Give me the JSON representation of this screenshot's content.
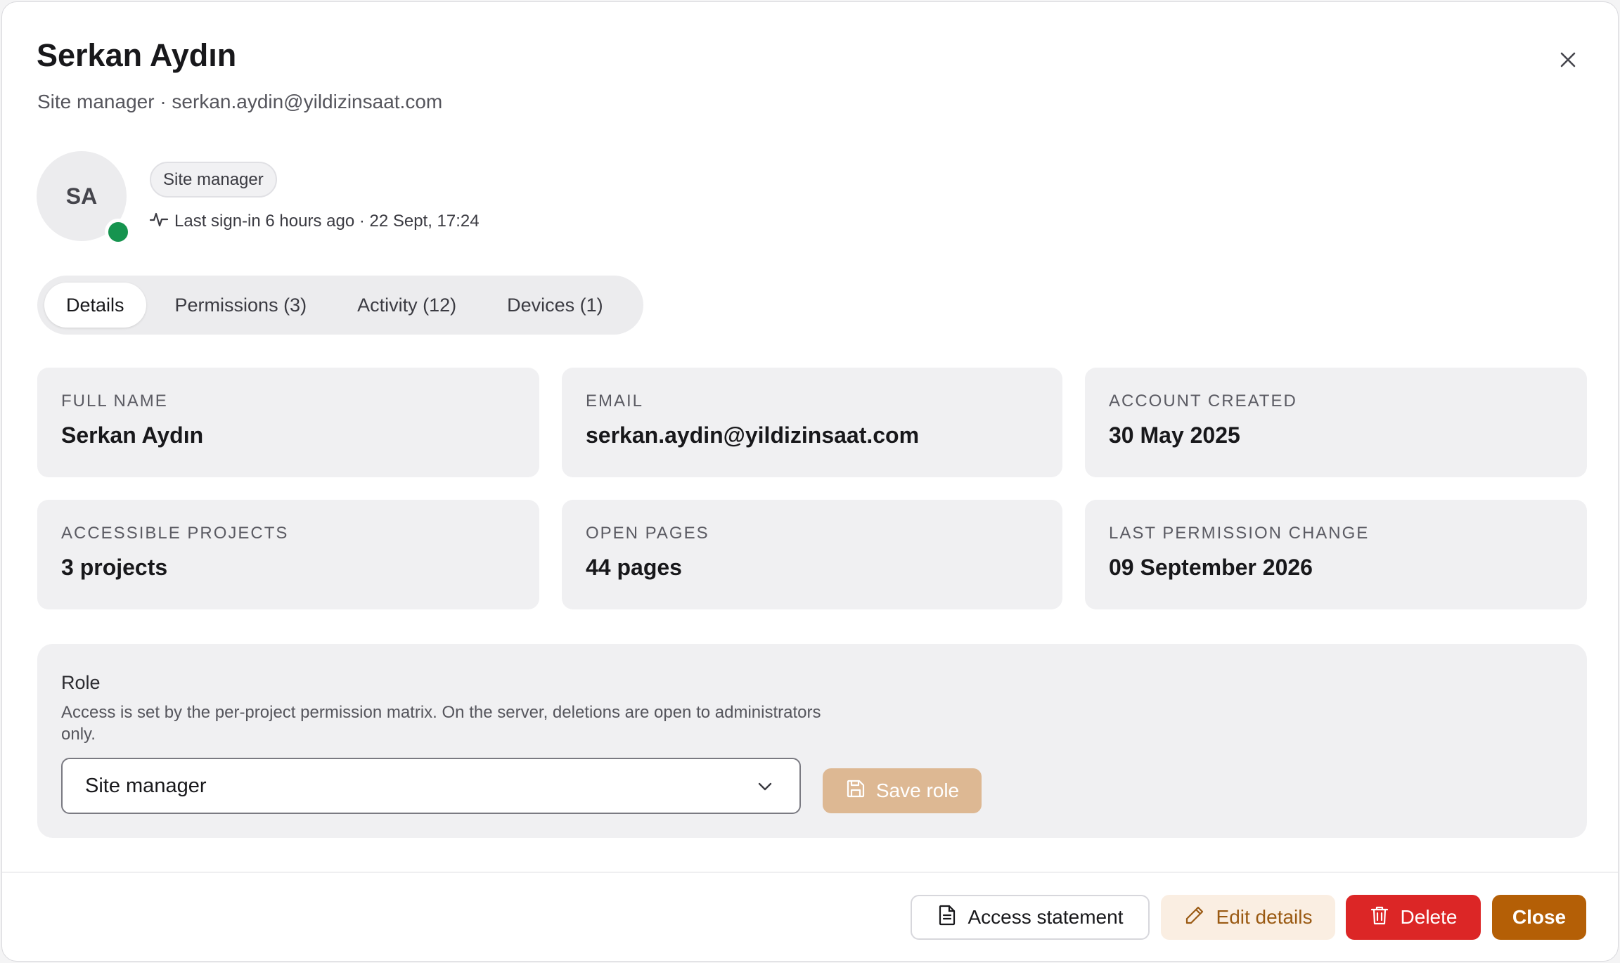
{
  "header": {
    "name": "Serkan Aydın",
    "subtitle": "Site manager · serkan.aydin@yildizinsaat.com",
    "close_icon": "close-icon"
  },
  "profile": {
    "initials": "SA",
    "presence_color": "#16944f",
    "role_chip": "Site manager",
    "last_signin": "Last sign-in 6 hours ago · 22 Sept, 17:24",
    "signin_icon": "activity-icon"
  },
  "tabs": [
    {
      "label": "Details",
      "active": true
    },
    {
      "label": "Permissions (3)",
      "active": false
    },
    {
      "label": "Activity (12)",
      "active": false
    },
    {
      "label": "Devices (1)",
      "active": false
    }
  ],
  "details": [
    {
      "label": "FULL NAME",
      "value": "Serkan Aydın"
    },
    {
      "label": "EMAIL",
      "value": "serkan.aydin@yildizinsaat.com"
    },
    {
      "label": "ACCOUNT CREATED",
      "value": "30 May 2025"
    },
    {
      "label": "ACCESSIBLE PROJECTS",
      "value": "3 projects"
    },
    {
      "label": "OPEN PAGES",
      "value": "44 pages"
    },
    {
      "label": "LAST PERMISSION CHANGE",
      "value": "09 September 2026"
    }
  ],
  "role": {
    "title": "Role",
    "description": "Access is set by the per-project permission matrix. On the server, deletions are open to administrators only.",
    "selected": "Site manager",
    "save_label": "Save role"
  },
  "footer": {
    "access_statement": "Access statement",
    "edit_details": "Edit details",
    "delete": "Delete",
    "close": "Close"
  },
  "colors": {
    "accent": "#b45f06",
    "danger": "#dc2626",
    "save_disabled": "#ddb893",
    "edit_bg": "#faeee2"
  }
}
